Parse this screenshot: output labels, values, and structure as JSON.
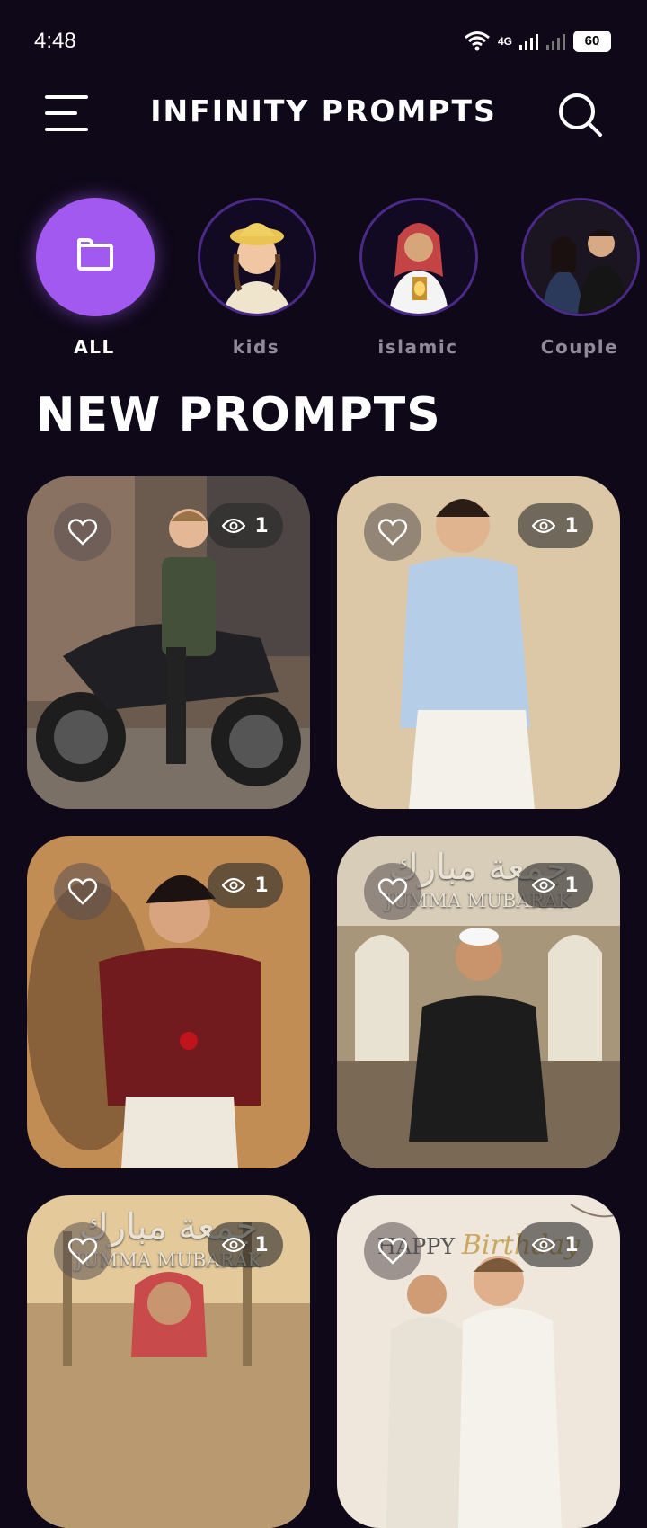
{
  "status": {
    "time": "4:48",
    "network": "4G",
    "battery": "60"
  },
  "header": {
    "title": "INFINITY PROMPTS"
  },
  "categories": [
    {
      "label": "ALL"
    },
    {
      "label": "kids"
    },
    {
      "label": "islamic"
    },
    {
      "label": "Couple"
    }
  ],
  "section": {
    "title": "NEW PROMPTS"
  },
  "cards": [
    {
      "views": "1"
    },
    {
      "views": "1"
    },
    {
      "views": "1"
    },
    {
      "views": "1",
      "arabic": "جمعة مبارك",
      "caption": "JUMMA MUBARAK"
    },
    {
      "views": "1",
      "arabic": "جمعة مبارك",
      "caption": "JUMMA MUBARAK"
    },
    {
      "views": "1",
      "caption_a": "HAPPY",
      "caption_b": "Birthday"
    }
  ]
}
